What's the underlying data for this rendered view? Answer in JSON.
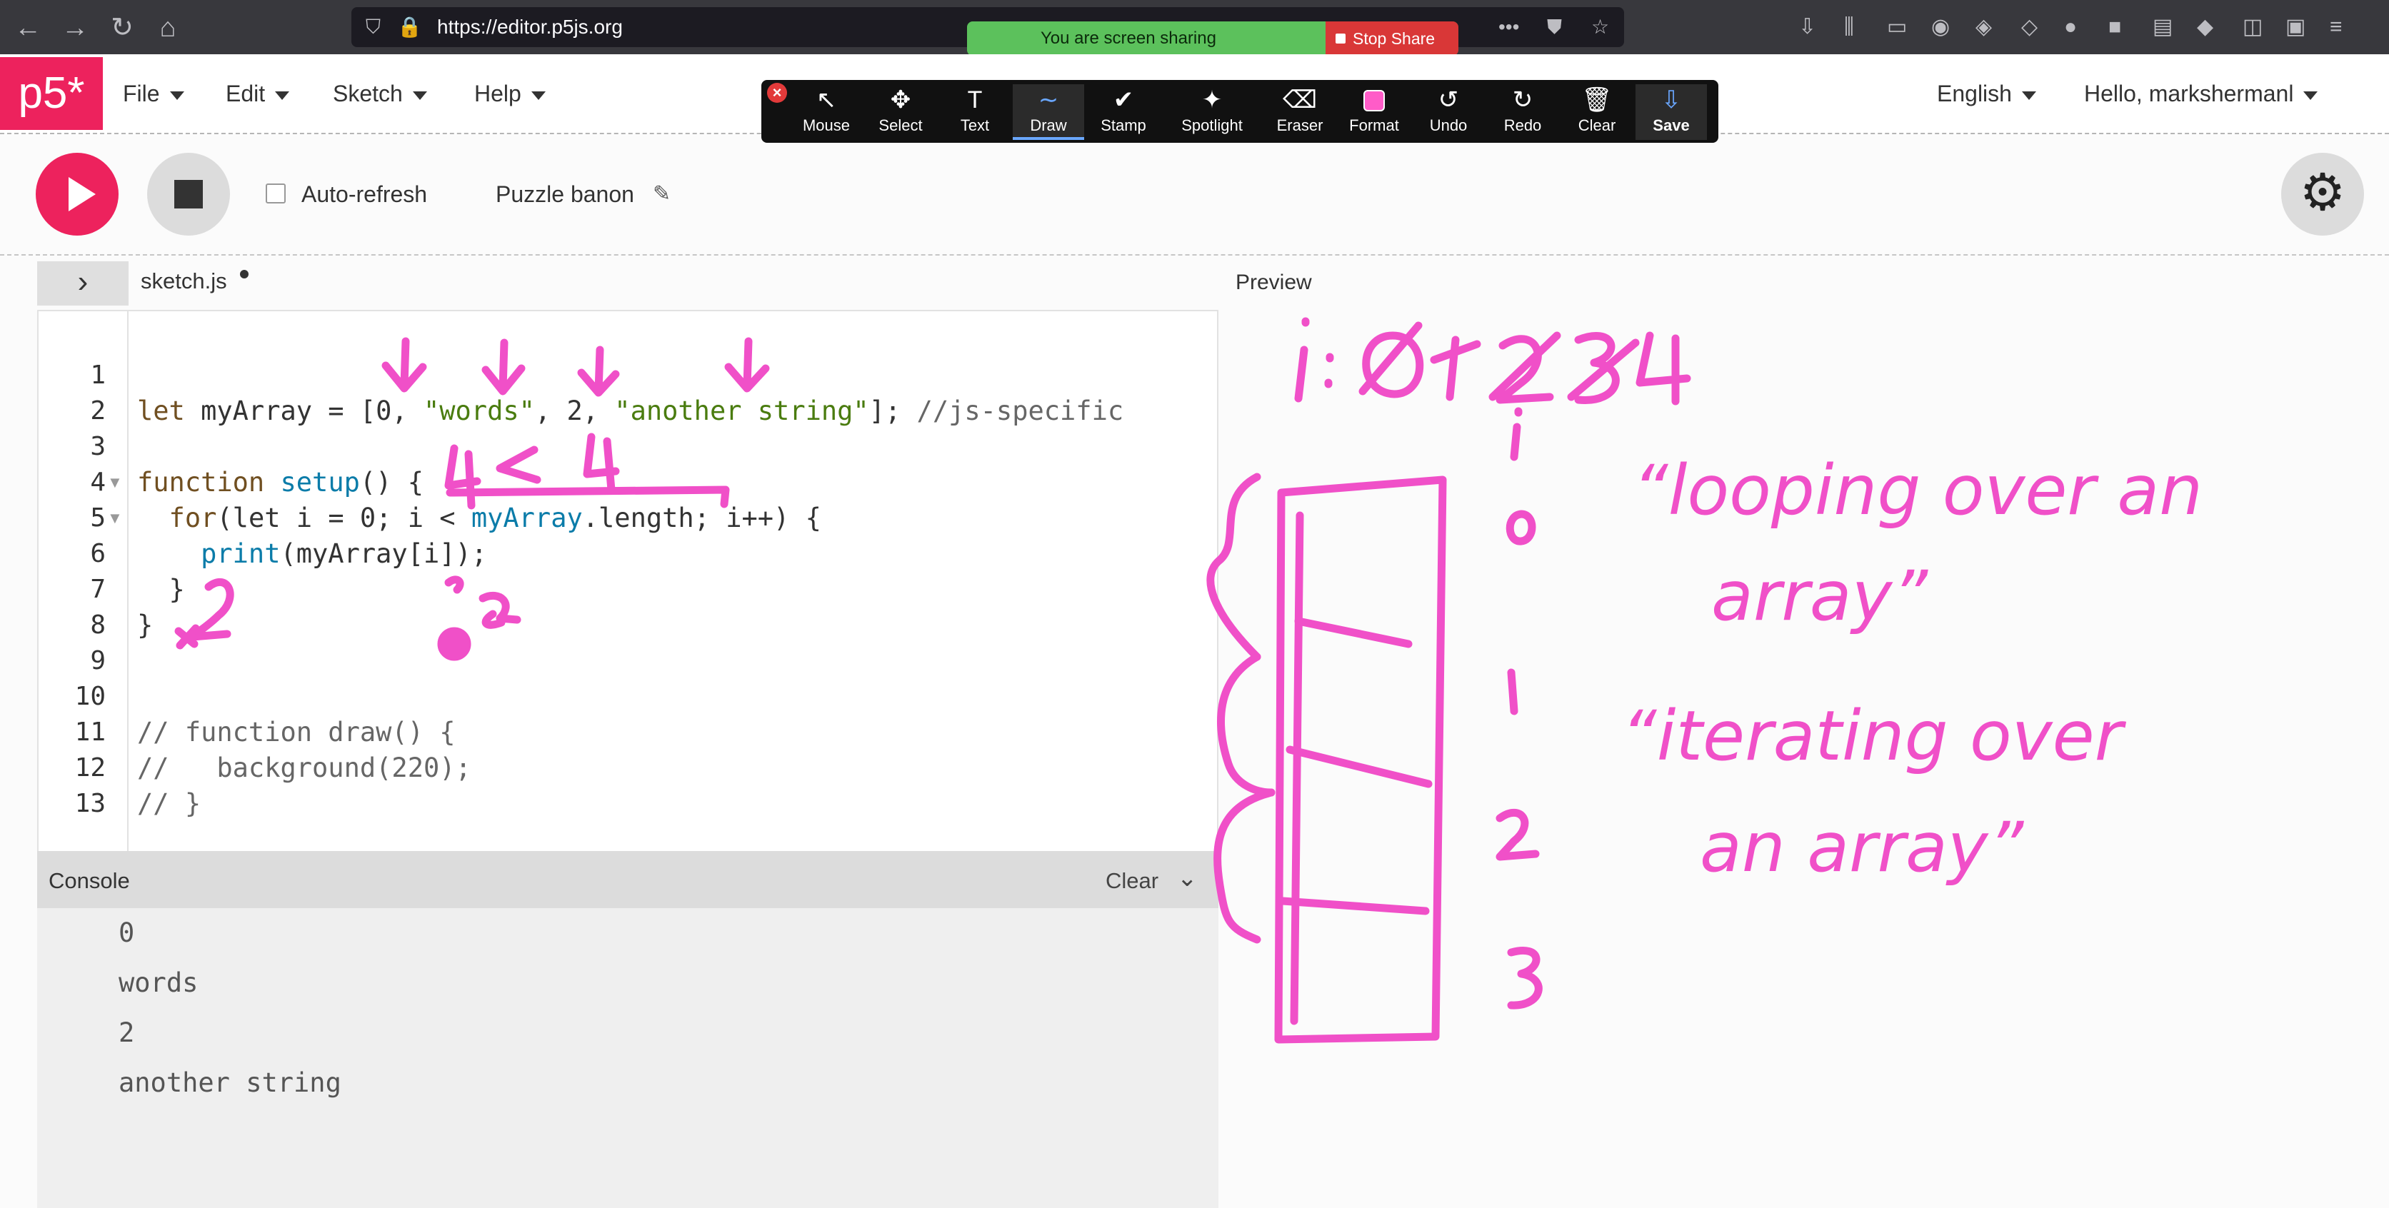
{
  "browser": {
    "url": "https://editor.p5js.org",
    "zoom_hint": "100%"
  },
  "screen_share": {
    "status": "You are screen sharing",
    "stop_label": "Stop Share"
  },
  "annotation_toolbar": {
    "tools": [
      {
        "label": "Mouse",
        "icon": "↖"
      },
      {
        "label": "Select",
        "icon": "✥"
      },
      {
        "label": "Text",
        "icon": "T"
      },
      {
        "label": "Draw",
        "icon": "∼"
      },
      {
        "label": "Stamp",
        "icon": "✔"
      },
      {
        "label": "Spotlight",
        "icon": "✦"
      },
      {
        "label": "Eraser",
        "icon": "⌫"
      },
      {
        "label": "Format",
        "icon": ""
      },
      {
        "label": "Undo",
        "icon": "↺"
      },
      {
        "label": "Redo",
        "icon": "↻"
      },
      {
        "label": "Clear",
        "icon": "🗑"
      },
      {
        "label": "Save",
        "icon": "⇩"
      }
    ]
  },
  "p5nav": {
    "logo": "p5*",
    "menu": [
      "File",
      "Edit",
      "Sketch",
      "Help"
    ],
    "language": "English",
    "user": "Hello, markshermanl"
  },
  "toolbar": {
    "autorefresh_label": "Auto-refresh",
    "project_name": "Puzzle banon"
  },
  "editor": {
    "filename": "sketch.js",
    "line_numbers": [
      "1",
      "2",
      "3",
      "4",
      "5",
      "6",
      "7",
      "8",
      "9",
      "10",
      "11",
      "12",
      "13"
    ]
  },
  "console": {
    "title": "Console",
    "clear_label": "Clear",
    "lines": [
      "0",
      "words",
      "2",
      "another string"
    ]
  },
  "preview": {
    "label": "Preview"
  }
}
